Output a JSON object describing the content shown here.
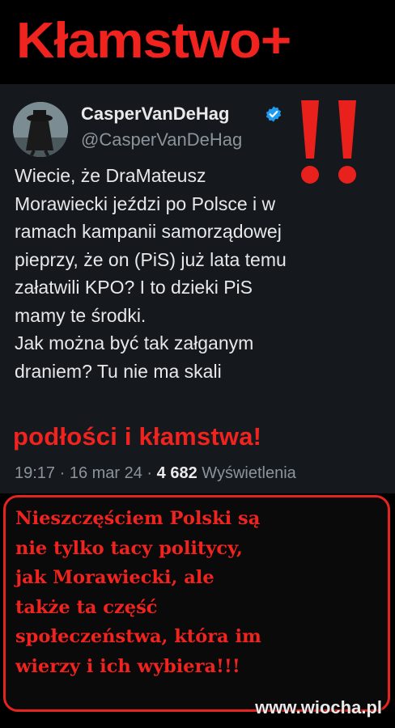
{
  "header": {
    "title": "Kłamstwo+"
  },
  "tweet": {
    "display_name": "CasperVanDeHag",
    "handle": "@CasperVanDeHag",
    "body": "Wiecie, że DraMateusz\nMorawiecki jeździ po Polsce i w\nramach kampanii samorządowej\npieprzy, że on (PiS) już lata temu\nzałatwili KPO? I to dzieki PiS\nmamy te środki.\nJak można być tak załganym\ndraniem? Tu nie ma skali",
    "emphasis": "podłości i kłamstwa!",
    "time": "19:17 · 16 mar 24 · ",
    "views_count": "4 682",
    "views_label": " Wyświetlenia"
  },
  "caption": {
    "text": "Nieszczęściem Polski są\nnie tylko tacy politycy,\njak Morawiecki, ale\ntakże ta część\nspołeczeństwa, która im\nwierzy i ich wybiera!!!"
  },
  "watermark": "www.wiocha.pl",
  "colors": {
    "accent_red": "#f0231f",
    "tweet_bg": "#15181c",
    "verified_blue": "#1d9bf0"
  }
}
